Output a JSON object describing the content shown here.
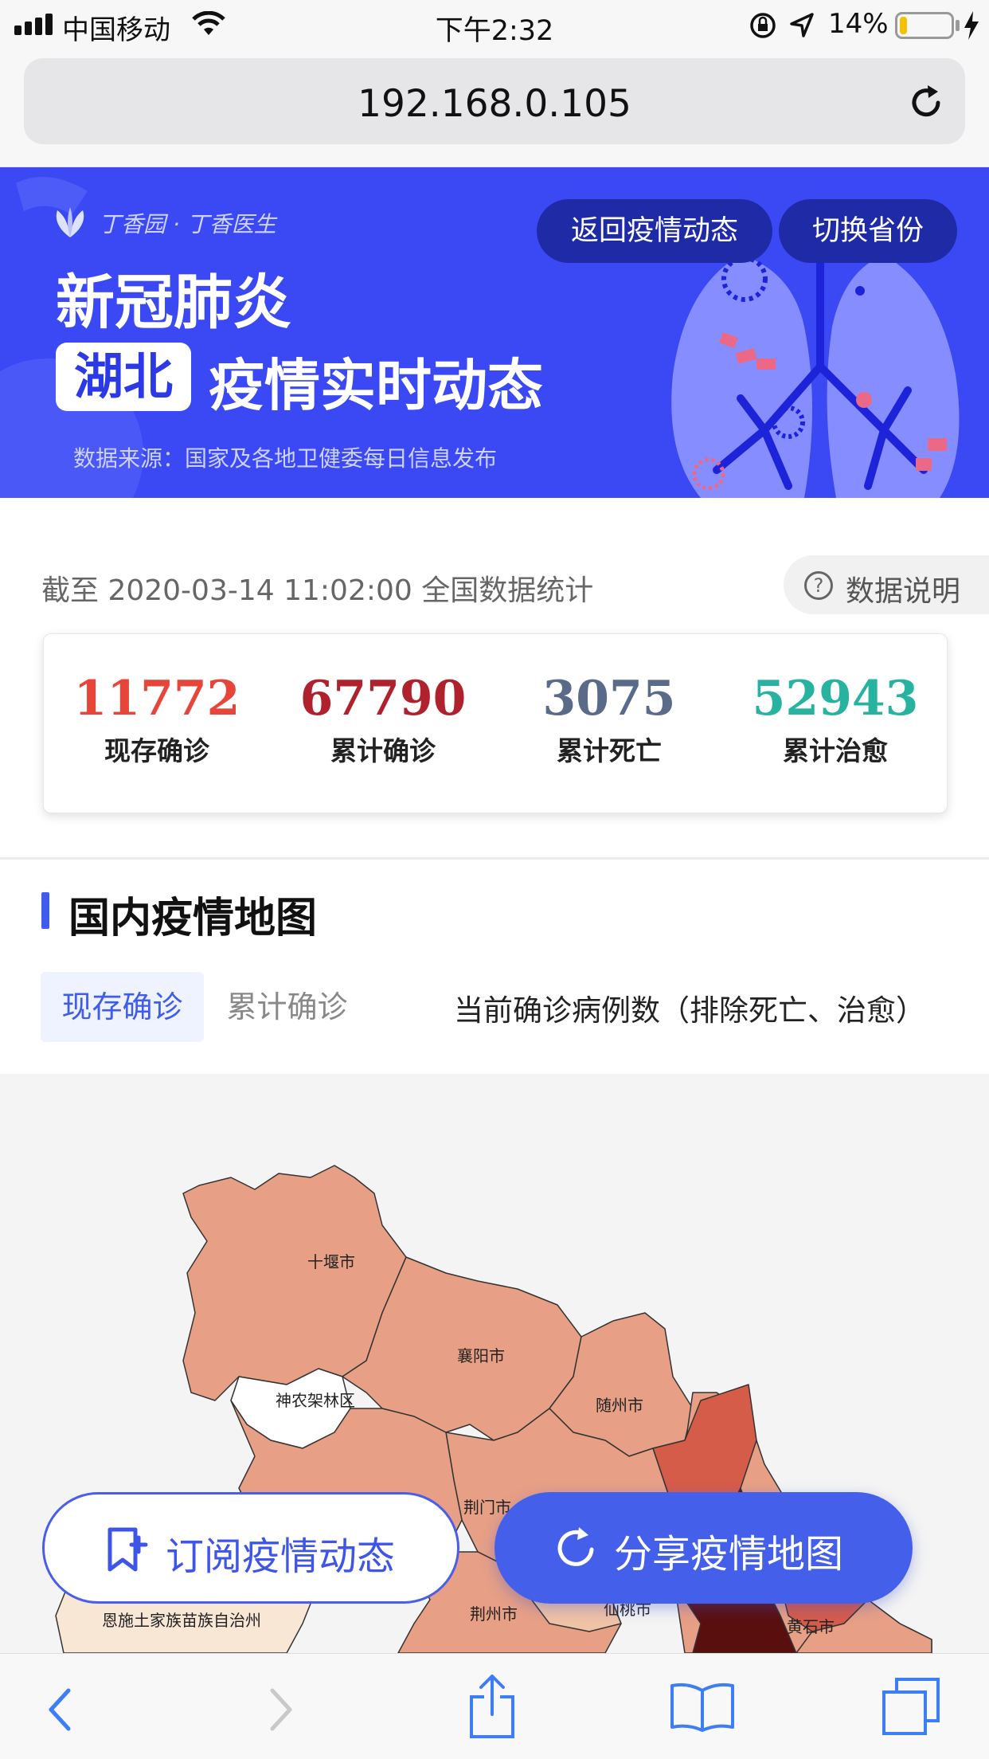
{
  "status_bar": {
    "carrier": "中国移动",
    "time": "下午2:32",
    "battery": "14%",
    "battery_level": 0.14
  },
  "address_bar": {
    "url": "192.168.0.105"
  },
  "banner": {
    "brand": "丁香园 · 丁香医生",
    "back_button": "返回疫情动态",
    "switch_button": "切换省份",
    "title": "新冠肺炎",
    "province": "湖北",
    "subtitle": "疫情实时动态",
    "source": "数据来源：国家及各地卫健委每日信息发布"
  },
  "stats": {
    "as_of": "截至 2020-03-14 11:02:00 全国数据统计",
    "help_label": "数据说明",
    "items": [
      {
        "value": "11772",
        "label": "现存确诊",
        "color": "#e8453a"
      },
      {
        "value": "67790",
        "label": "累计确诊",
        "color": "#b0212e"
      },
      {
        "value": "3075",
        "label": "累计死亡",
        "color": "#5a6a89"
      },
      {
        "value": "52943",
        "label": "累计治愈",
        "color": "#27b3a0"
      }
    ]
  },
  "map_section": {
    "title": "国内疫情地图",
    "tabs": [
      "现存确诊",
      "累计确诊"
    ],
    "active_tab": "现存确诊",
    "description": "当前确诊病例数（排除死亡、治愈）",
    "cities": [
      "十堰市",
      "襄阳市",
      "神农架林区",
      "随州市",
      "荆门市",
      "恩施土家族苗族自治州",
      "荆州市",
      "仙桃市",
      "黄石市"
    ]
  },
  "actions": {
    "subscribe": "订阅疫情动态",
    "share": "分享疫情地图"
  },
  "toolbar_icons": [
    "back-icon",
    "forward-icon",
    "share-icon",
    "bookmarks-icon",
    "tabs-icon"
  ]
}
